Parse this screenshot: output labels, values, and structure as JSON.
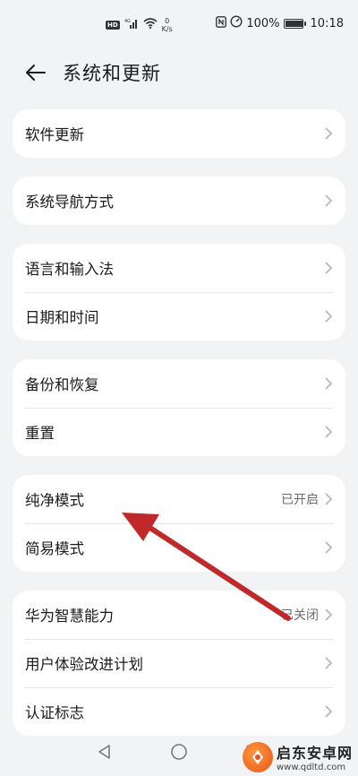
{
  "status_bar": {
    "hd_label": "HD",
    "signal_label": "4G",
    "net_speed_value": "0",
    "net_speed_unit": "K/s",
    "battery_percent": "100%",
    "battery_level": 1.0,
    "time": "10:18",
    "icons": [
      "nfc-icon",
      "data-saver-icon",
      "wifi-icon",
      "signal-icon",
      "battery-icon"
    ]
  },
  "header": {
    "title": "系统和更新"
  },
  "groups": [
    {
      "items": [
        {
          "label": "软件更新",
          "value": ""
        }
      ]
    },
    {
      "items": [
        {
          "label": "系统导航方式",
          "value": ""
        }
      ]
    },
    {
      "items": [
        {
          "label": "语言和输入法",
          "value": ""
        },
        {
          "label": "日期和时间",
          "value": ""
        }
      ]
    },
    {
      "items": [
        {
          "label": "备份和恢复",
          "value": ""
        },
        {
          "label": "重置",
          "value": ""
        }
      ]
    },
    {
      "items": [
        {
          "label": "纯净模式",
          "value": "已开启"
        },
        {
          "label": "简易模式",
          "value": ""
        }
      ]
    },
    {
      "items": [
        {
          "label": "华为智慧能力",
          "value": "已关闭"
        },
        {
          "label": "用户体验改进计划",
          "value": ""
        },
        {
          "label": "认证标志",
          "value": ""
        }
      ]
    }
  ],
  "annotation": {
    "arrow_color": "#c0282a"
  },
  "watermark": {
    "title": "启东安卓网",
    "url": "www.qdltd.com"
  },
  "nav": {
    "icons": [
      "back-triangle-icon",
      "home-circle-icon",
      "recents-square-icon"
    ]
  }
}
